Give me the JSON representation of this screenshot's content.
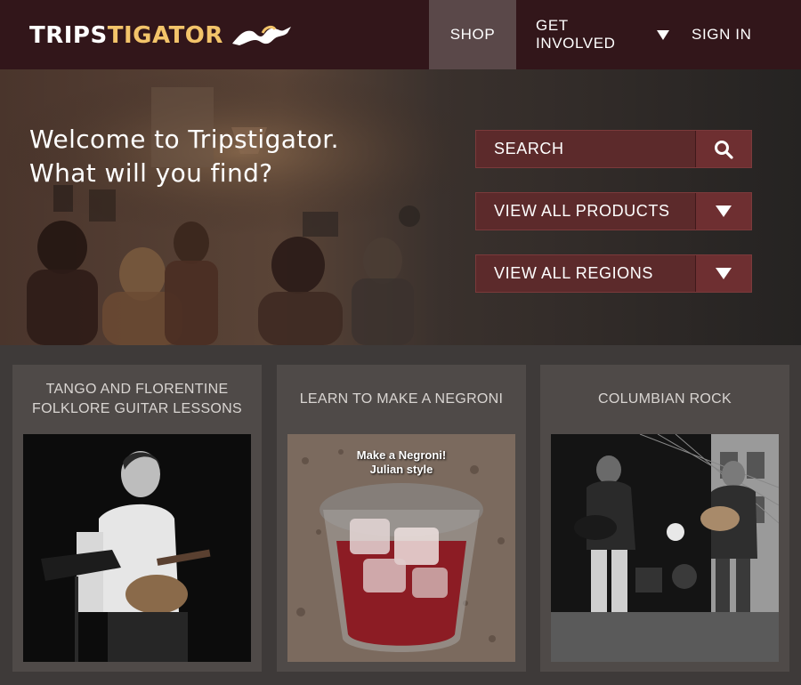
{
  "brand": {
    "name_part1": "TRIPS",
    "name_part2": "TIGATOR",
    "accent": "#f3c46a",
    "mark_icon": "bird-logo-icon"
  },
  "nav": {
    "shop": "SHOP",
    "get_involved": "GET INVOLVED",
    "sign_in": "SIGN IN",
    "background": "#32161a",
    "active_background": "#5a4849"
  },
  "hero": {
    "title_line1": "Welcome to Tripstigator.",
    "title_line2": "What will you find?",
    "search_label": "SEARCH",
    "search_icon": "search-icon",
    "products_label": "VIEW ALL PRODUCTS",
    "regions_label": "VIEW ALL REGIONS",
    "box_color": "#5c2a2b"
  },
  "cards": [
    {
      "title": "TANGO AND FLORENTINE FOLKLORE GUITAR LESSONS"
    },
    {
      "title": "LEARN TO MAKE A NEGRONI",
      "image_caption_line1": "Make a Negroni!",
      "image_caption_line2": "Julian style"
    },
    {
      "title": "COLUMBIAN ROCK"
    }
  ]
}
